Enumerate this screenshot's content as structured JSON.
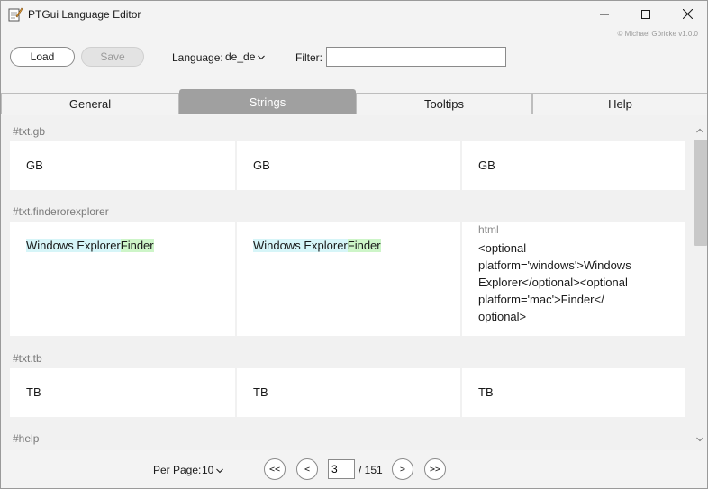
{
  "window": {
    "title": "PTGui Language Editor",
    "copyright": "© Michael Göricke v1.0.0"
  },
  "toolbar": {
    "load_label": "Load",
    "save_label": "Save",
    "language_label": "Language:",
    "language_value": "de_de",
    "filter_label": "Filter:",
    "filter_value": "",
    "filter_placeholder": ""
  },
  "tabs": [
    {
      "label": "General",
      "active": false
    },
    {
      "label": "Strings",
      "active": true
    },
    {
      "label": "Tooltips",
      "active": false
    },
    {
      "label": "Help",
      "active": false
    }
  ],
  "entries": [
    {
      "key": "#txt.gb",
      "col1": "GB",
      "col2": "GB",
      "col3": "GB"
    },
    {
      "key": "#txt.finderorexplorer",
      "col1_part_a": "Windows Explorer",
      "col1_part_b": "Finder",
      "col2_part_a": "Windows Explorer",
      "col2_part_b": "Finder",
      "col3_type": "html",
      "col3_code": "<optional\nplatform='windows'>Windows\nExplorer</optional><optional\nplatform='mac'>Finder</\noptional>"
    },
    {
      "key": "#txt.tb",
      "col1": "TB",
      "col2": "TB",
      "col3": "TB"
    },
    {
      "key": "#help"
    }
  ],
  "pagination": {
    "per_page_label": "Per Page:",
    "per_page_value": "10",
    "first_label": "<<",
    "prev_label": "<",
    "current_page": "3",
    "total_label": "/ 151",
    "next_label": ">",
    "last_label": ">>"
  },
  "colors": {
    "active_tab": "#a0a0a0",
    "highlight_cyan": "#d6f5f8",
    "highlight_green": "#cdf5c8"
  },
  "icons": {
    "app": "notepad-pencil-icon",
    "minimize": "minimize-icon",
    "maximize": "maximize-icon",
    "close": "close-icon",
    "dropdown": "chevron-down-icon"
  }
}
